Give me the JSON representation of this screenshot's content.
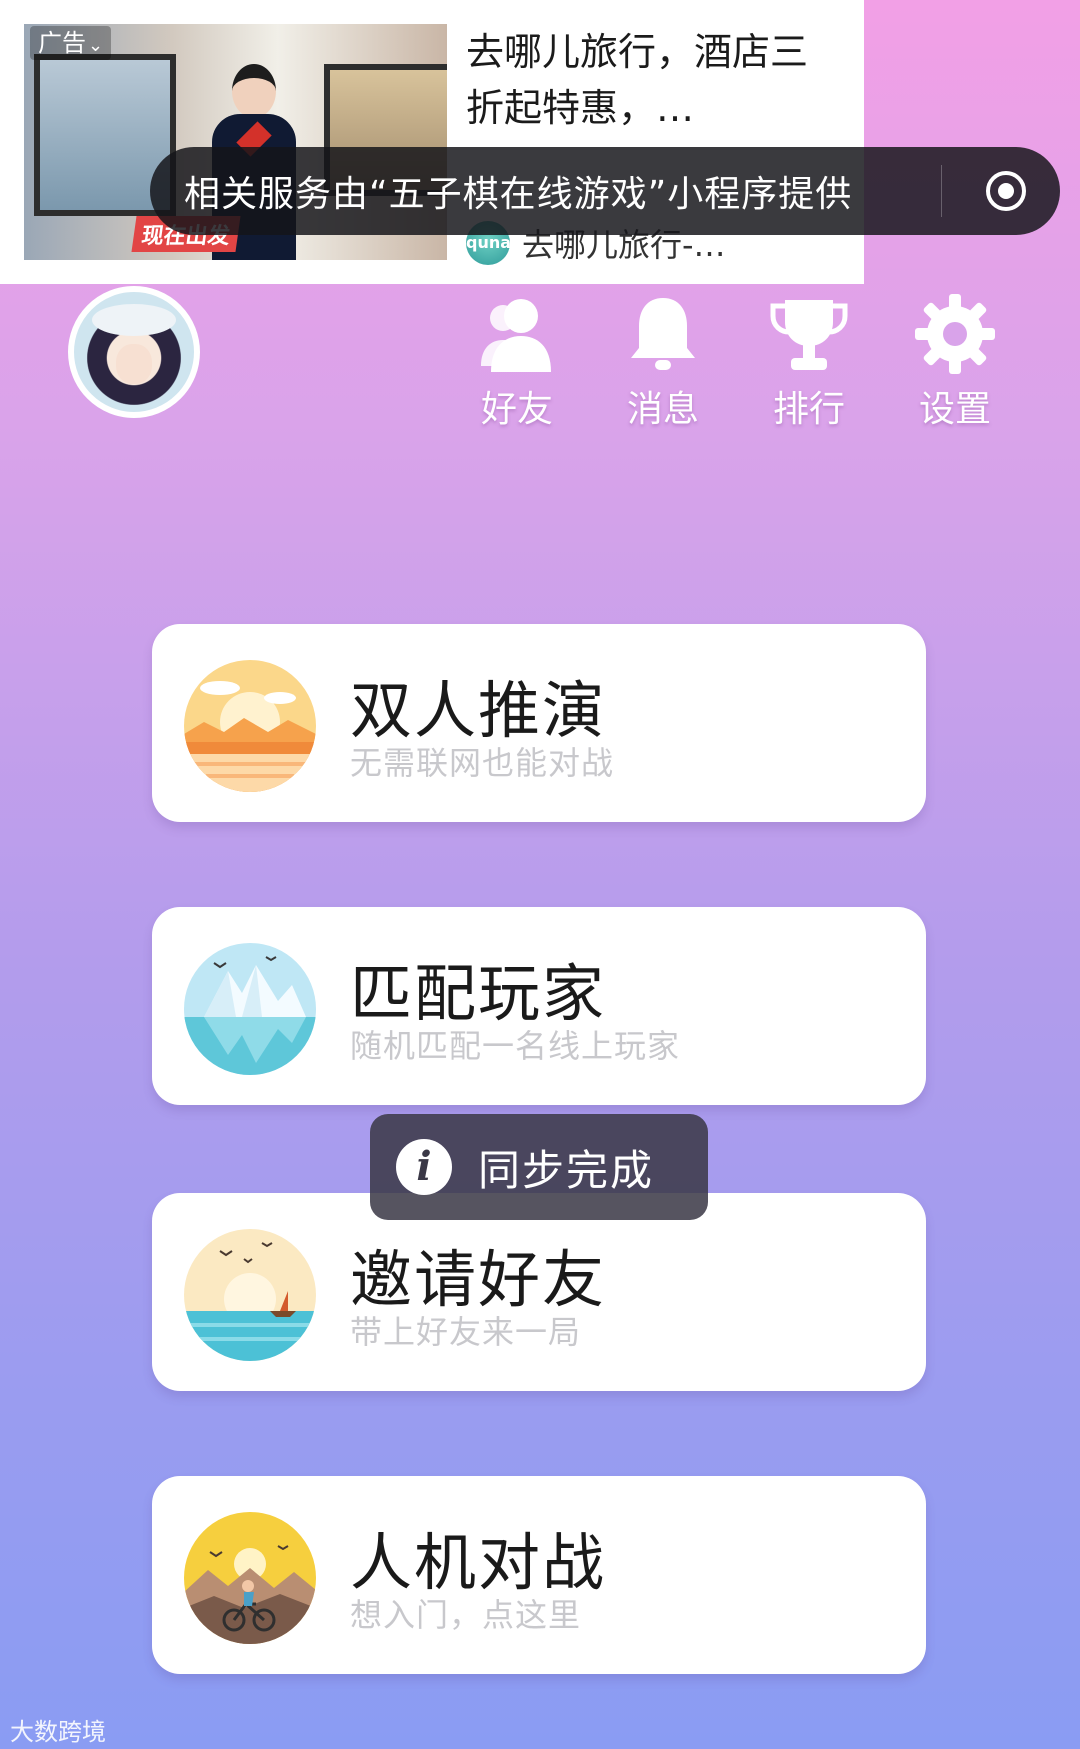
{
  "ad": {
    "tag": "广告",
    "title": "去哪儿旅行，酒店三折起特惠，…",
    "thumb_caption": "现在出发",
    "source_name": "去哪儿旅行-…",
    "source_logo_text": "qunar"
  },
  "service_notice": {
    "text": "相关服务由“五子棋在线游戏”小程序提供"
  },
  "nav": [
    {
      "label": "好友",
      "icon": "friends-icon"
    },
    {
      "label": "消息",
      "icon": "bell-icon"
    },
    {
      "label": "排行",
      "icon": "trophy-icon"
    },
    {
      "label": "设置",
      "icon": "gear-icon"
    }
  ],
  "menu": [
    {
      "title": "双人推演",
      "subtitle": "无需联网也能对战"
    },
    {
      "title": "匹配玩家",
      "subtitle": "随机匹配一名线上玩家"
    },
    {
      "title": "邀请好友",
      "subtitle": "带上好友来一局"
    },
    {
      "title": "人机对战",
      "subtitle": "想入门，点这里"
    }
  ],
  "toast": {
    "text": "同步完成",
    "icon": "info-icon"
  },
  "watermark": "大数跨境"
}
